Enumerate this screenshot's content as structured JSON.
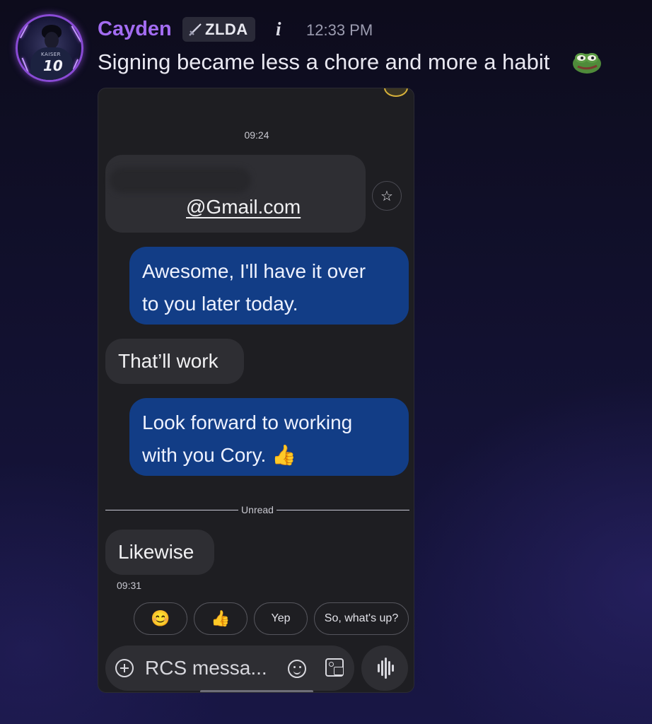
{
  "message": {
    "username": "Cayden",
    "tag": {
      "icon": "sword-icon",
      "label": "ZLDA"
    },
    "info_glyph": "i",
    "timestamp": "12:33 PM",
    "text": "Signing became less a chore and more a habit",
    "avatar": {
      "jersey_name": "KAISER",
      "jersey_number": "10"
    },
    "emoji": "pepe-emoji"
  },
  "attachment": {
    "top_time": "09:24",
    "email_fragment": "@Gmail.com",
    "messages": [
      {
        "side": "out",
        "lines": [
          "Awesome, I'll have it over",
          "to you later today."
        ]
      },
      {
        "side": "in",
        "lines": [
          "That’ll work"
        ]
      },
      {
        "side": "out",
        "lines": [
          "Look forward to working",
          "with you Cory. 👍"
        ]
      },
      {
        "side": "in",
        "lines": [
          "Likewise"
        ]
      }
    ],
    "unread_label": "Unread",
    "last_time": "09:31",
    "suggestions": [
      "😊",
      "👍",
      "Yep",
      "So, what's up?"
    ],
    "composer_placeholder": "RCS messa...",
    "colors": {
      "outgoing_bubble": "#123d86",
      "incoming_bubble": "#2e2e33",
      "username": "#a36cf2"
    }
  }
}
